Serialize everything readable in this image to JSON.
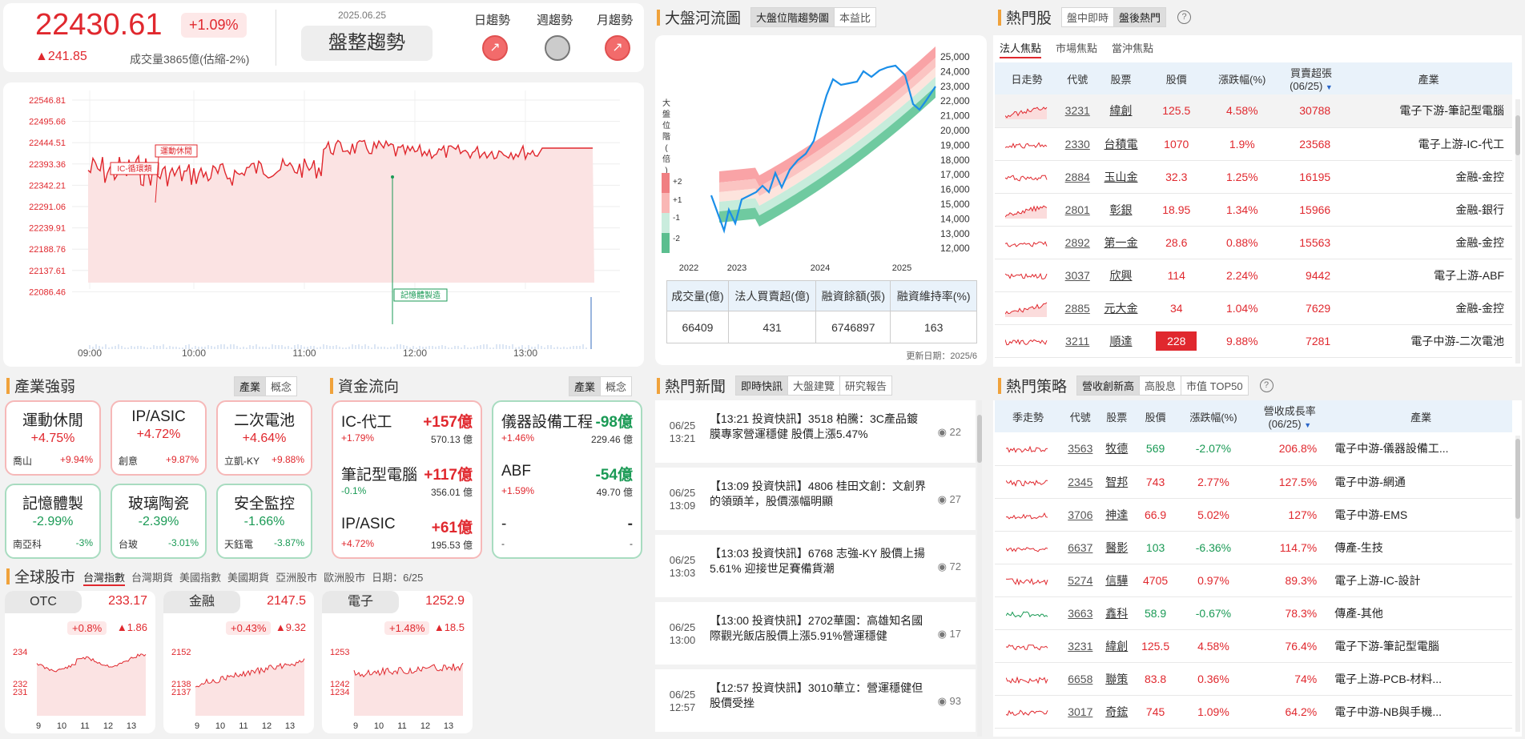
{
  "header": {
    "index": "22430.61",
    "pct": "+1.09%",
    "change": "▲241.85",
    "volume": "成交量3865億(估縮-2%)",
    "date": "2025.06.25",
    "trend": "盤整趨勢",
    "day_label": "日趨勢",
    "week_label": "週趨勢",
    "month_label": "月趨勢"
  },
  "intraday": {
    "y_labels": [
      "22546.81",
      "22495.66",
      "22444.51",
      "22393.36",
      "22342.21",
      "22291.06",
      "22239.91",
      "22188.76",
      "22137.61",
      "22086.46"
    ],
    "x_labels": [
      "09:00",
      "10:00",
      "11:00",
      "12:00",
      "13:00"
    ],
    "tags": [
      "IC-循環類",
      "運動休閒",
      "記憶體製造"
    ]
  },
  "river": {
    "title": "大盤河流圖",
    "tabs": [
      "大盤位階趨勢圖",
      "本益比"
    ],
    "side_label": "大盤位階(倍)",
    "band_labels": [
      "+2",
      "+1",
      "-1",
      "-2"
    ],
    "y_labels": [
      "25,000",
      "24,000",
      "23,000",
      "22,000",
      "21,000",
      "20,000",
      "19,000",
      "18,000",
      "17,000",
      "16,000",
      "15,000",
      "14,000",
      "13,000",
      "12,000"
    ],
    "x_labels": [
      "2022",
      "2023",
      "2024",
      "2025"
    ],
    "table_headers": [
      "成交量(億)",
      "法人買賣超(億)",
      "融資餘額(張)",
      "融資維持率(%)"
    ],
    "table_values": [
      "66409",
      "431",
      "6746897",
      "163"
    ],
    "updated": "更新日期：2025/6"
  },
  "hot": {
    "title": "熱門股",
    "tabs": [
      "盤中即時",
      "盤後熱門"
    ],
    "subtabs": [
      "法人焦點",
      "市場焦點",
      "當沖焦點"
    ],
    "headers": [
      "日走勢",
      "代號",
      "股票",
      "股價",
      "漲跌幅(%)",
      "買賣超張",
      "(06/25)",
      "產業"
    ],
    "rows": [
      [
        "3231",
        "緯創",
        "125.5",
        "4.58%",
        "30788",
        "電子下游-筆記型電腦",
        "r"
      ],
      [
        "2330",
        "台積電",
        "1070",
        "1.9%",
        "23568",
        "電子上游-IC-代工",
        "r"
      ],
      [
        "2884",
        "玉山金",
        "32.3",
        "1.25%",
        "16195",
        "金融-金控",
        "r"
      ],
      [
        "2801",
        "彰銀",
        "18.95",
        "1.34%",
        "15966",
        "金融-銀行",
        "r"
      ],
      [
        "2892",
        "第一金",
        "28.6",
        "0.88%",
        "15563",
        "金融-金控",
        "r"
      ],
      [
        "3037",
        "欣興",
        "114",
        "2.24%",
        "9442",
        "電子上游-ABF",
        "r"
      ],
      [
        "2885",
        "元大金",
        "34",
        "1.04%",
        "7629",
        "金融-金控",
        "r"
      ],
      [
        "3211",
        "順達",
        "228",
        "9.88%",
        "7281",
        "電子中游-二次電池",
        "lim"
      ]
    ]
  },
  "industry": {
    "title": "產業強弱",
    "tabs": [
      "產業",
      "概念"
    ],
    "cards": [
      {
        "name": "運動休閒",
        "pct": "+4.75%",
        "stock": "喬山",
        "spct": "+9.94%",
        "c": "r"
      },
      {
        "name": "IP/ASIC",
        "pct": "+4.72%",
        "stock": "創意",
        "spct": "+9.87%",
        "c": "r"
      },
      {
        "name": "二次電池",
        "pct": "+4.64%",
        "stock": "立凱-KY",
        "spct": "+9.88%",
        "c": "r"
      },
      {
        "name": "記憶體製",
        "pct": "-2.99%",
        "stock": "南亞科",
        "spct": "-3%",
        "c": "g"
      },
      {
        "name": "玻璃陶瓷",
        "pct": "-2.39%",
        "stock": "台玻",
        "spct": "-3.01%",
        "c": "g"
      },
      {
        "name": "安全監控",
        "pct": "-1.66%",
        "stock": "天鈺電",
        "spct": "-3.87%",
        "c": "g"
      }
    ]
  },
  "fund": {
    "title": "資金流向",
    "tabs": [
      "產業",
      "概念"
    ],
    "left": [
      {
        "name": "IC-代工",
        "val": "+157億",
        "pct": "+1.79%",
        "amt": "570.13 億",
        "c": "r"
      },
      {
        "name": "筆記型電腦",
        "val": "+117億",
        "pct": "-0.1%",
        "amt": "356.01 億",
        "c": "g"
      },
      {
        "name": "IP/ASIC",
        "val": "+61億",
        "pct": "+4.72%",
        "amt": "195.53 億",
        "c": "r"
      }
    ],
    "right": [
      {
        "name": "儀器設備工程",
        "val": "-98億",
        "pct": "+1.46%",
        "amt": "229.46 億",
        "c": "r"
      },
      {
        "name": "ABF",
        "val": "-54億",
        "pct": "+1.59%",
        "amt": "49.70 億",
        "c": "r"
      },
      {
        "name": "-",
        "val": "-",
        "pct": "-",
        "amt": "-",
        "c": "n"
      }
    ]
  },
  "global": {
    "title": "全球股市",
    "tabs": [
      "台灣指數",
      "台灣期貨",
      "美國指數",
      "美國期貨",
      "亞洲股市",
      "歐洲股市"
    ],
    "date": "日期：6/25",
    "cards": [
      {
        "name": "OTC",
        "val": "233.17",
        "pct": "+0.8%",
        "chg": "▲1.86",
        "y": [
          "234",
          "232",
          "231"
        ],
        "x": [
          "9",
          "10",
          "11",
          "12",
          "13"
        ]
      },
      {
        "name": "金融",
        "val": "2147.5",
        "pct": "+0.43%",
        "chg": "▲9.32",
        "y": [
          "2152",
          "2138",
          "2137"
        ],
        "x": [
          "9",
          "10",
          "11",
          "12",
          "13"
        ]
      },
      {
        "name": "電子",
        "val": "1252.9",
        "pct": "+1.48%",
        "chg": "▲18.5",
        "y": [
          "1253",
          "1242",
          "1234"
        ],
        "x": [
          "9",
          "10",
          "11",
          "12",
          "13"
        ]
      }
    ]
  },
  "news": {
    "title": "熱門新聞",
    "tabs": [
      "即時快訊",
      "大盤建覽",
      "研究報告"
    ],
    "items": [
      {
        "d": "06/25",
        "t": "13:21",
        "txt": "【13:21 投資快訊】3518 柏騰：3C產品鍍膜專家營運穩健 股價上漲5.47%",
        "v": "22"
      },
      {
        "d": "06/25",
        "t": "13:09",
        "txt": "【13:09 投資快訊】4806 桂田文創：文創界的領頭羊，股價漲幅明顯",
        "v": "27"
      },
      {
        "d": "06/25",
        "t": "13:03",
        "txt": "【13:03 投資快訊】6768 志強-KY 股價上揚 5.61% 迎接世足賽備貨潮",
        "v": "72"
      },
      {
        "d": "06/25",
        "t": "13:00",
        "txt": "【13:00 投資快訊】2702華園：高雄知名國際觀光飯店股價上漲5.91%營運穩健",
        "v": "17"
      },
      {
        "d": "06/25",
        "t": "12:57",
        "txt": "【12:57 投資快訊】3010華立：營運穩健但股價受挫",
        "v": "93"
      }
    ]
  },
  "strategy": {
    "title": "熱門策略",
    "tabs": [
      "營收創新高",
      "高股息",
      "市值 TOP50"
    ],
    "headers": [
      "季走勢",
      "代號",
      "股票",
      "股價",
      "漲跌幅(%)",
      "營收成長率",
      "(06/25)",
      "產業"
    ],
    "rows": [
      [
        "3563",
        "牧德",
        "569",
        "-2.07%",
        "206.8%",
        "電子中游-儀器設備工...",
        "g"
      ],
      [
        "2345",
        "智邦",
        "743",
        "2.77%",
        "127.5%",
        "電子中游-網通",
        "r"
      ],
      [
        "3706",
        "神達",
        "66.9",
        "5.02%",
        "127%",
        "電子中游-EMS",
        "r"
      ],
      [
        "6637",
        "醫影",
        "103",
        "-6.36%",
        "114.7%",
        "傳產-生技",
        "g"
      ],
      [
        "5274",
        "信驊",
        "4705",
        "0.97%",
        "89.3%",
        "電子上游-IC-設計",
        "r"
      ],
      [
        "3663",
        "鑫科",
        "58.9",
        "-0.67%",
        "78.3%",
        "傳產-其他",
        "g"
      ],
      [
        "3231",
        "緯創",
        "125.5",
        "4.58%",
        "76.4%",
        "電子下游-筆記型電腦",
        "r"
      ],
      [
        "6658",
        "聯策",
        "83.8",
        "0.36%",
        "74%",
        "電子上游-PCB-材料...",
        "r"
      ],
      [
        "3017",
        "奇鋐",
        "745",
        "1.09%",
        "64.2%",
        "電子中游-NB與手機...",
        "r"
      ]
    ]
  }
}
